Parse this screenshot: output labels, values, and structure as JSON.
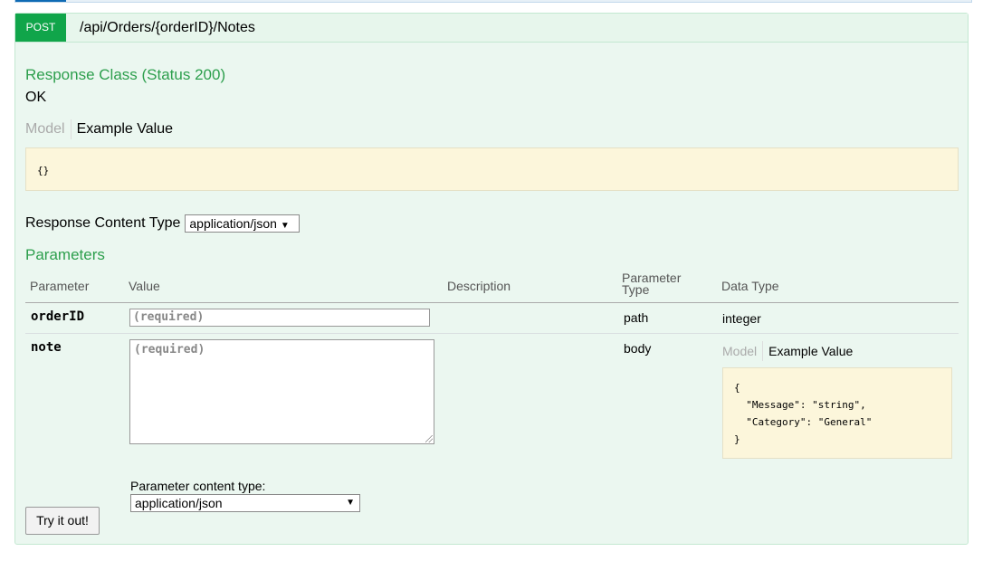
{
  "operation": {
    "method": "POST",
    "path": "/api/Orders/{orderID}/Notes"
  },
  "response_class": {
    "heading": "Response Class (Status 200)",
    "status_text": "OK",
    "tabs": {
      "model": "Model",
      "example": "Example Value"
    },
    "example_json": "{}"
  },
  "response_content_type": {
    "label": "Response Content Type",
    "selected": "application/json"
  },
  "parameters": {
    "heading": "Parameters",
    "columns": {
      "parameter": "Parameter",
      "value": "Value",
      "description": "Description",
      "parameter_type_1": "Parameter",
      "parameter_type_2": "Type",
      "data_type": "Data Type"
    },
    "rows": [
      {
        "name": "orderID",
        "placeholder": "(required)",
        "param_type": "path",
        "data_type": "integer"
      },
      {
        "name": "note",
        "placeholder": "(required)",
        "param_type": "body",
        "model_tabs": {
          "model": "Model",
          "example": "Example Value"
        },
        "example_lines": [
          "{",
          "  \"Message\": \"string\",",
          "  \"Category\": \"General\"",
          "}"
        ],
        "content_type_label": "Parameter content type:",
        "content_type_selected": "application/json"
      }
    ]
  },
  "try_button": "Try it out!",
  "colors": {
    "post_green": "#10a54a",
    "heading_green": "#2d9f4d",
    "panel_bg": "#ebf7f0",
    "code_bg": "#fcf6db"
  }
}
